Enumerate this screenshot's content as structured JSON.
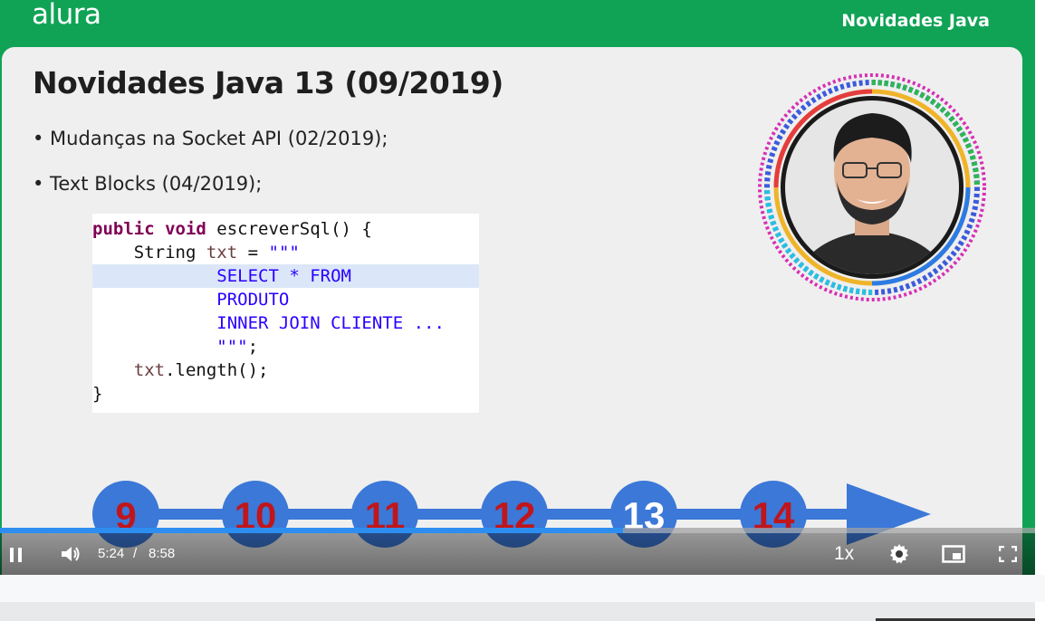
{
  "header": {
    "brand": "alura",
    "course_label": "Novidades Java"
  },
  "slide": {
    "title": "Novidades Java 13 (09/2019)",
    "bullets": [
      "• Mudanças na Socket API (02/2019);",
      "• Text Blocks (04/2019);"
    ],
    "code": {
      "l0_kw": "public void",
      "l0_rest": " escreverSql() {",
      "l1_a": "    String ",
      "l1_var": "txt",
      "l1_b": " = ",
      "l1_str": "\"\"\"",
      "l2": "            SELECT * FROM",
      "l3": "            PRODUTO",
      "l4": "            INNER JOIN CLIENTE ...",
      "l5_str": "            \"\"\"",
      "l5_end": ";",
      "l6_var": "    txt",
      "l6_rest": ".length();",
      "l7": "}"
    },
    "timeline": {
      "versions": [
        "9",
        "10",
        "11",
        "12",
        "13",
        "14"
      ],
      "highlighted": "13",
      "colors": {
        "circle": "#3b78d8",
        "number": "#c0161b",
        "highlight_number": "#ffffff",
        "line": "#3b78d8"
      }
    }
  },
  "player": {
    "time_current": "5:24",
    "time_separator": "/",
    "time_total": "8:58",
    "progress": 0.602,
    "speed": "1x",
    "icons": [
      "pause-icon",
      "volume-icon",
      "settings-icon",
      "pip-icon",
      "fullscreen-icon"
    ]
  },
  "colors": {
    "brand_green": "#10a356",
    "progress_blue": "#2e8ef0"
  }
}
